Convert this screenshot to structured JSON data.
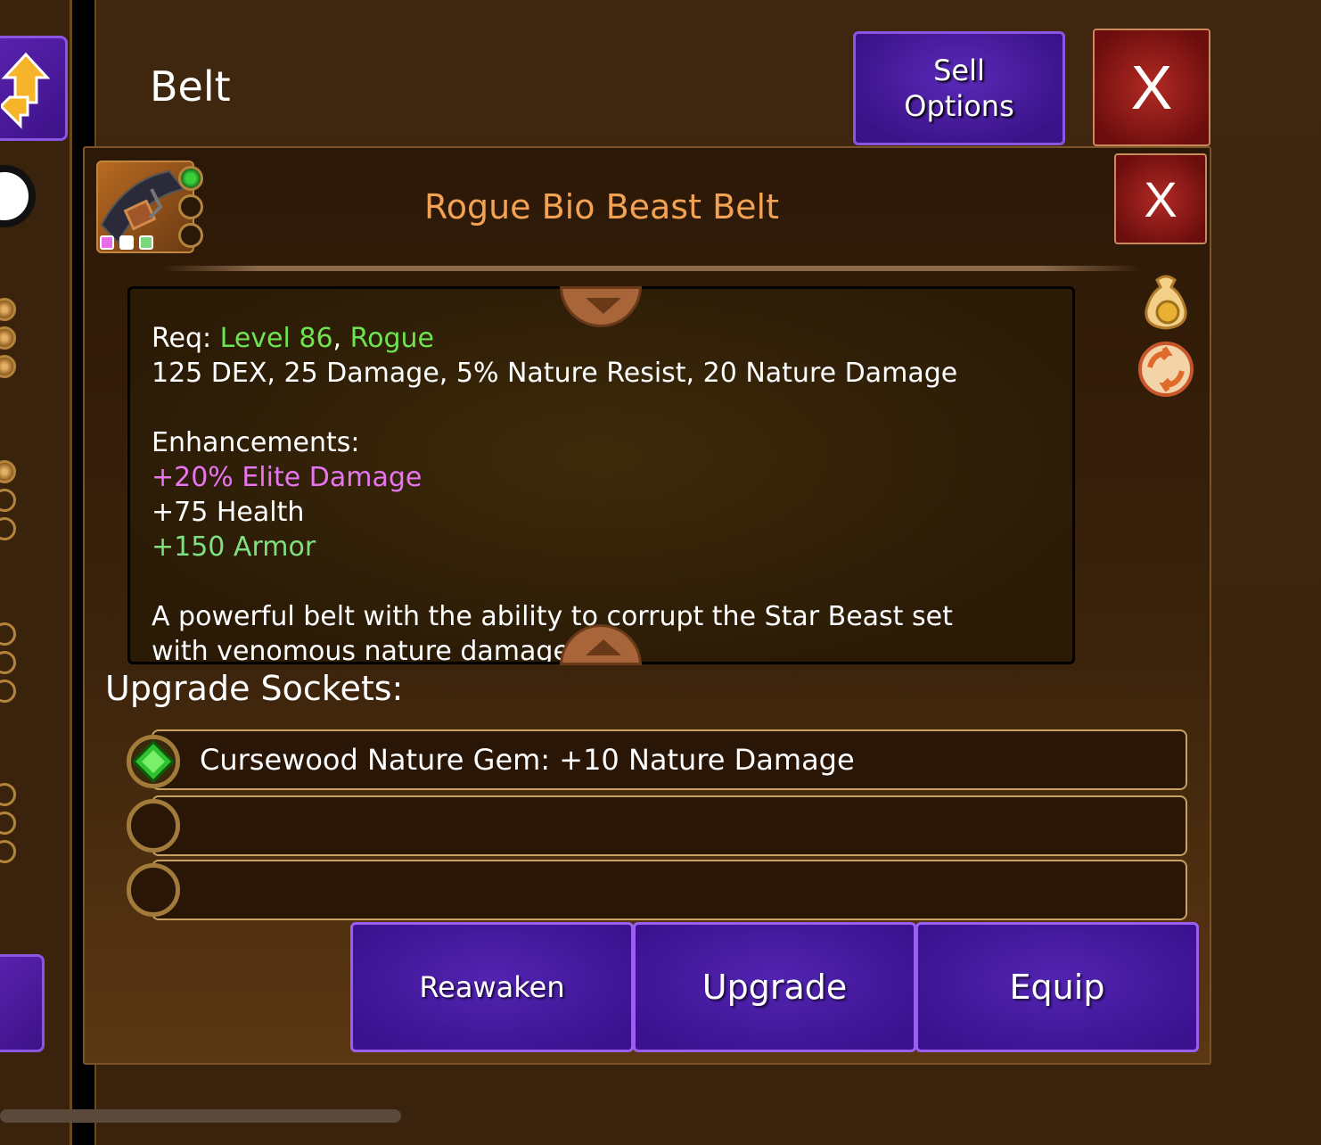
{
  "header": {
    "slot_title": "Belt",
    "sell_options_label": "Sell Options",
    "close_label": "X"
  },
  "item": {
    "name": "Rogue Bio Beast Belt",
    "close_label": "X",
    "rarity_colors": [
      "#e86de8",
      "#ffffff",
      "#7cd67c"
    ],
    "description": {
      "req_prefix": "Req: ",
      "req_level": "Level 86",
      "req_sep": ", ",
      "req_class": "Rogue",
      "stats": "125 DEX, 25 Damage, 5% Nature Resist, 20 Nature Damage",
      "enhancements_heading": "Enhancements:",
      "enhancement_1": "+20% Elite Damage",
      "enhancement_2": "+75 Health",
      "enhancement_3": "+150 Armor",
      "flavor": "A powerful belt with the ability to corrupt the Star Beast set",
      "flavor_cut": "with venomous nature damage"
    }
  },
  "sockets": {
    "label": "Upgrade Sockets:",
    "slots": [
      {
        "text": "Cursewood Nature Gem: +10 Nature Damage",
        "filled": true
      },
      {
        "text": "",
        "filled": false
      },
      {
        "text": "",
        "filled": false
      }
    ]
  },
  "actions": {
    "reawaken": "Reawaken",
    "upgrade": "Upgrade",
    "equip": "Equip"
  },
  "icons": {
    "swap": "swap-arrows-icon",
    "gold_bag": "gold-bag-icon",
    "refresh": "refresh-icon",
    "gem": "green-gem-icon",
    "scroll_down": "scroll-down-icon",
    "scroll_up": "scroll-up-icon"
  },
  "colors": {
    "item_name": "#f2a252",
    "requirement": "#6ee450",
    "elite_enhancement": "#e875f0",
    "armor_enhancement": "#7ee07e",
    "button_purple": "#3a1290",
    "close_red": "#b22a24"
  }
}
